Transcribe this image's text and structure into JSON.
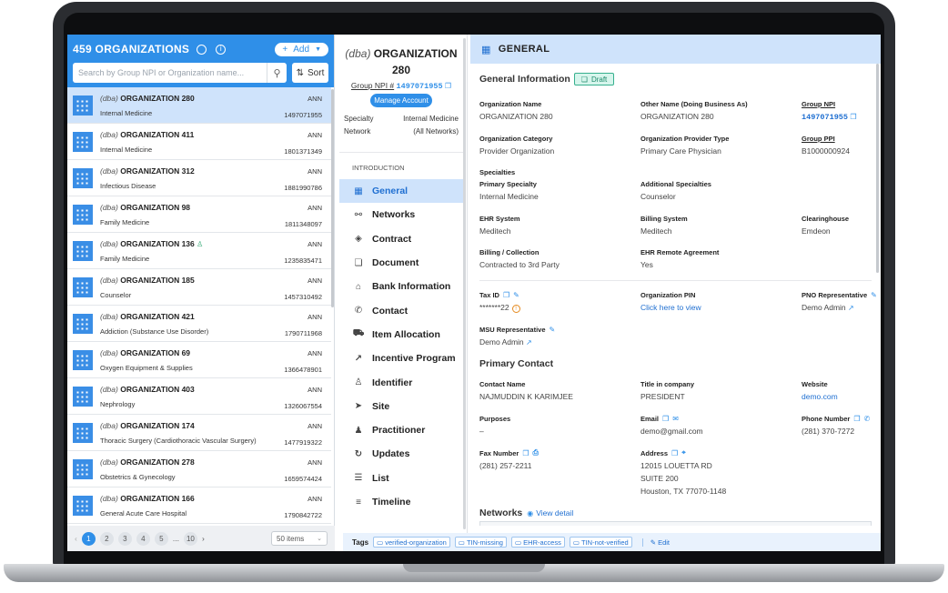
{
  "left": {
    "title": "459 ORGANIZATIONS",
    "add_label": "Add",
    "search_placeholder": "Search by Group NPI or Organization name...",
    "sort_label": "Sort",
    "items": [
      {
        "dba": "(dba)",
        "name": "ORGANIZATION 280",
        "sub": "Internal Medicine",
        "tag": "ANN",
        "npi": "1497071955"
      },
      {
        "dba": "(dba)",
        "name": "ORGANIZATION 411",
        "sub": "Internal Medicine",
        "tag": "ANN",
        "npi": "1801371349"
      },
      {
        "dba": "(dba)",
        "name": "ORGANIZATION 312",
        "sub": "Infectious Disease",
        "tag": "ANN",
        "npi": "1881990786"
      },
      {
        "dba": "(dba)",
        "name": "ORGANIZATION 98",
        "sub": "Family Medicine",
        "tag": "ANN",
        "npi": "1811348097"
      },
      {
        "dba": "(dba)",
        "name": "ORGANIZATION 136",
        "sub": "Family Medicine",
        "tag": "ANN",
        "npi": "1235835471"
      },
      {
        "dba": "(dba)",
        "name": "ORGANIZATION 185",
        "sub": "Counselor",
        "tag": "ANN",
        "npi": "1457310492"
      },
      {
        "dba": "(dba)",
        "name": "ORGANIZATION 421",
        "sub": "Addiction (Substance Use Disorder)",
        "tag": "ANN",
        "npi": "1790711968"
      },
      {
        "dba": "(dba)",
        "name": "ORGANIZATION 69",
        "sub": "Oxygen Equipment & Supplies",
        "tag": "ANN",
        "npi": "1366478901"
      },
      {
        "dba": "(dba)",
        "name": "ORGANIZATION 403",
        "sub": "Nephrology",
        "tag": "ANN",
        "npi": "1326067554"
      },
      {
        "dba": "(dba)",
        "name": "ORGANIZATION 174",
        "sub": "Thoracic Surgery (Cardiothoracic Vascular Surgery)",
        "tag": "ANN",
        "npi": "1477919322"
      },
      {
        "dba": "(dba)",
        "name": "ORGANIZATION 278",
        "sub": "Obstetrics & Gynecology",
        "tag": "ANN",
        "npi": "1659574424"
      },
      {
        "dba": "(dba)",
        "name": "ORGANIZATION 166",
        "sub": "General Acute Care Hospital",
        "tag": "ANN",
        "npi": "1790842722"
      }
    ],
    "pages": [
      "1",
      "2",
      "3",
      "4",
      "5",
      "...",
      "10"
    ],
    "per_page": "50 items"
  },
  "middle": {
    "dba": "(dba)",
    "name": "ORGANIZATION 280",
    "npi_label": "Group NPI #",
    "npi_value": "1497071955",
    "manage_label": "Manage Account",
    "specialty_label": "Specialty",
    "specialty_value": "Internal Medicine",
    "network_label": "Network",
    "network_value": "(All Networks)",
    "intro_label": "INTRODUCTION",
    "nav": [
      {
        "label": "General",
        "icon": "▦"
      },
      {
        "label": "Networks",
        "icon": "⚯"
      },
      {
        "label": "Contract",
        "icon": "◈"
      },
      {
        "label": "Document",
        "icon": "❏"
      },
      {
        "label": "Bank Information",
        "icon": "⌂"
      },
      {
        "label": "Contact",
        "icon": "✆"
      },
      {
        "label": "Item Allocation",
        "icon": "⛟"
      },
      {
        "label": "Incentive Program",
        "icon": "↗"
      },
      {
        "label": "Identifier",
        "icon": "♙"
      },
      {
        "label": "Site",
        "icon": "➤"
      },
      {
        "label": "Practitioner",
        "icon": "♟"
      },
      {
        "label": "Updates",
        "icon": "↻"
      },
      {
        "label": "List",
        "icon": "☰"
      },
      {
        "label": "Timeline",
        "icon": "≡"
      }
    ]
  },
  "right": {
    "header": "GENERAL",
    "general_info": "General Information",
    "draft": "Draft",
    "fields": {
      "org_name_l": "Organization Name",
      "org_name_v": "ORGANIZATION 280",
      "other_name_l": "Other Name (Doing Business As)",
      "other_name_v": "ORGANIZATION 280",
      "group_npi_l": "Group NPI",
      "group_npi_v": "1497071955",
      "org_cat_l": "Organization Category",
      "org_cat_v": "Provider Organization",
      "org_prov_type_l": "Organization Provider Type",
      "org_prov_type_v": "Primary Care Physician",
      "group_ppi_l": "Group PPI",
      "group_ppi_v": "B1000000924",
      "specialties_l": "Specialties",
      "primary_spec_l": "Primary Specialty",
      "primary_spec_v": "Internal Medicine",
      "add_spec_l": "Additional Specialties",
      "add_spec_v": "Counselor",
      "ehr_l": "EHR System",
      "ehr_v": "Meditech",
      "billing_sys_l": "Billing System",
      "billing_sys_v": "Meditech",
      "clearing_l": "Clearinghouse",
      "clearing_v": "Emdeon",
      "billing_col_l": "Billing / Collection",
      "billing_col_v": "Contracted to 3rd Party",
      "ehr_remote_l": "EHR Remote Agreement",
      "ehr_remote_v": "Yes",
      "tax_id_l": "Tax ID",
      "tax_id_v": "*******22",
      "org_pin_l": "Organization PIN",
      "org_pin_v": "Click here to view",
      "pno_l": "PNO Representative",
      "pno_v": "Demo Admin",
      "msu_l": "MSU Representative",
      "msu_v": "Demo Admin"
    },
    "primary_contact": "Primary Contact",
    "contact": {
      "name_l": "Contact Name",
      "name_v": "NAJMUDDIN K KARIMJEE",
      "title_l": "Title in company",
      "title_v": "PRESIDENT",
      "web_l": "Website",
      "web_v": "demo.com",
      "purposes_l": "Purposes",
      "purposes_v": "–",
      "email_l": "Email",
      "email_v": "demo@gmail.com",
      "phone_l": "Phone Number",
      "phone_v": "(281) 370-7272",
      "fax_l": "Fax Number",
      "fax_v": "(281) 257-2211",
      "addr_l": "Address",
      "addr_1": "12015 LOUETTA RD",
      "addr_2": "SUITE 200",
      "addr_3": "Houston, TX 77070-1148"
    },
    "networks": "Networks",
    "view_detail": "View detail"
  },
  "tags": {
    "label": "Tags",
    "items": [
      "verified-organization",
      "TIN-missing",
      "EHR-access",
      "TIN-not-verified"
    ],
    "edit": "Edit"
  }
}
